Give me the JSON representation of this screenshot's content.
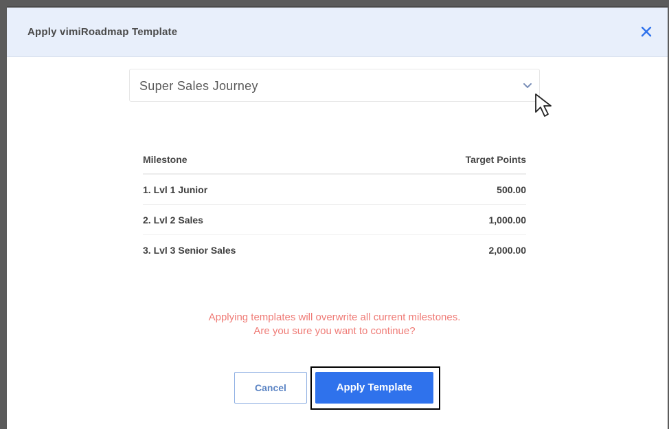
{
  "dialog": {
    "title": "Apply vimiRoadmap Template",
    "close_icon": "close-icon"
  },
  "template_select": {
    "selected": "Super Sales Journey",
    "chevron_icon": "chevron-down-icon"
  },
  "table": {
    "headers": [
      "Milestone",
      "Target Points"
    ],
    "rows": [
      [
        "1. Lvl 1 Junior",
        "500.00"
      ],
      [
        "2. Lvl 2 Sales",
        "1,000.00"
      ],
      [
        "3. Lvl 3 Senior Sales",
        "2,000.00"
      ]
    ]
  },
  "warning": {
    "line1": "Applying templates will overwrite all current milestones.",
    "line2": "Are you sure you want to continue?"
  },
  "buttons": {
    "cancel": "Cancel",
    "apply": "Apply Template"
  },
  "colors": {
    "header_bg": "#e8effb",
    "primary": "#2f72ec",
    "warning": "#ef7b76"
  }
}
